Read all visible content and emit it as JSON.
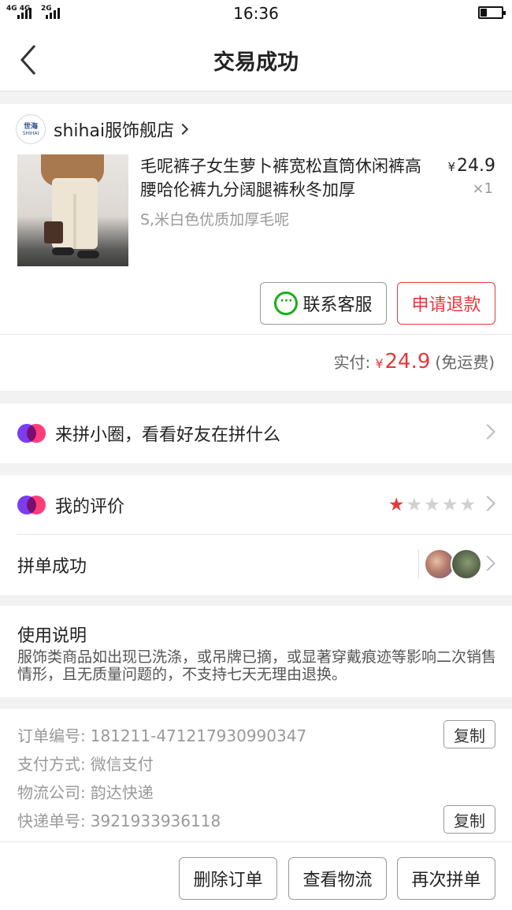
{
  "statusbar": {
    "signal1_label": "4G 4G",
    "signal2_label": "2G",
    "time": "16:36"
  },
  "header": {
    "title": "交易成功"
  },
  "order": {
    "shop_name": "shihai服饰舰店",
    "shop_logo_text": "世海",
    "shop_logo_sub": "SHIHAI",
    "product_title": "毛呢裤子女生萝卜裤宽松直筒休闲裤高腰哈伦裤九分阔腿裤秋冬加厚",
    "product_spec": "S,米白色优质加厚毛呢",
    "price_symbol": "¥",
    "price": "24.9",
    "quantity": "×1",
    "contact_label": "联系客服",
    "refund_label": "申请退款",
    "paid_label": "实付:",
    "paid_symbol": "¥",
    "paid_amount": "24.9",
    "shipping_note": "(免运费)"
  },
  "circle_row": {
    "label": "来拼小圈，看看好友在拼什么"
  },
  "review_row": {
    "label": "我的评价",
    "rating": 1,
    "max_rating": 5
  },
  "group_row": {
    "label": "拼单成功"
  },
  "usage": {
    "title": "使用说明",
    "text": "服饰类商品如出现已洗涤，或吊牌已摘，或显著穿戴痕迹等影响二次销售情形，且无质量问题的，不支持七天无理由退换。"
  },
  "info": {
    "order_no_label": "订单编号:",
    "order_no": "181211-471217930990347",
    "pay_method_label": "支付方式:",
    "pay_method": "微信支付",
    "courier_label": "物流公司:",
    "courier": "韵达快递",
    "tracking_label": "快递单号:",
    "tracking_no": "3921933936118",
    "copy_label": "复制"
  },
  "actions": {
    "delete_label": "删除订单",
    "logistics_label": "查看物流",
    "regroup_label": "再次拼单"
  },
  "colors": {
    "accent_red": "#e4393c",
    "wechat_green": "#1aad19"
  }
}
